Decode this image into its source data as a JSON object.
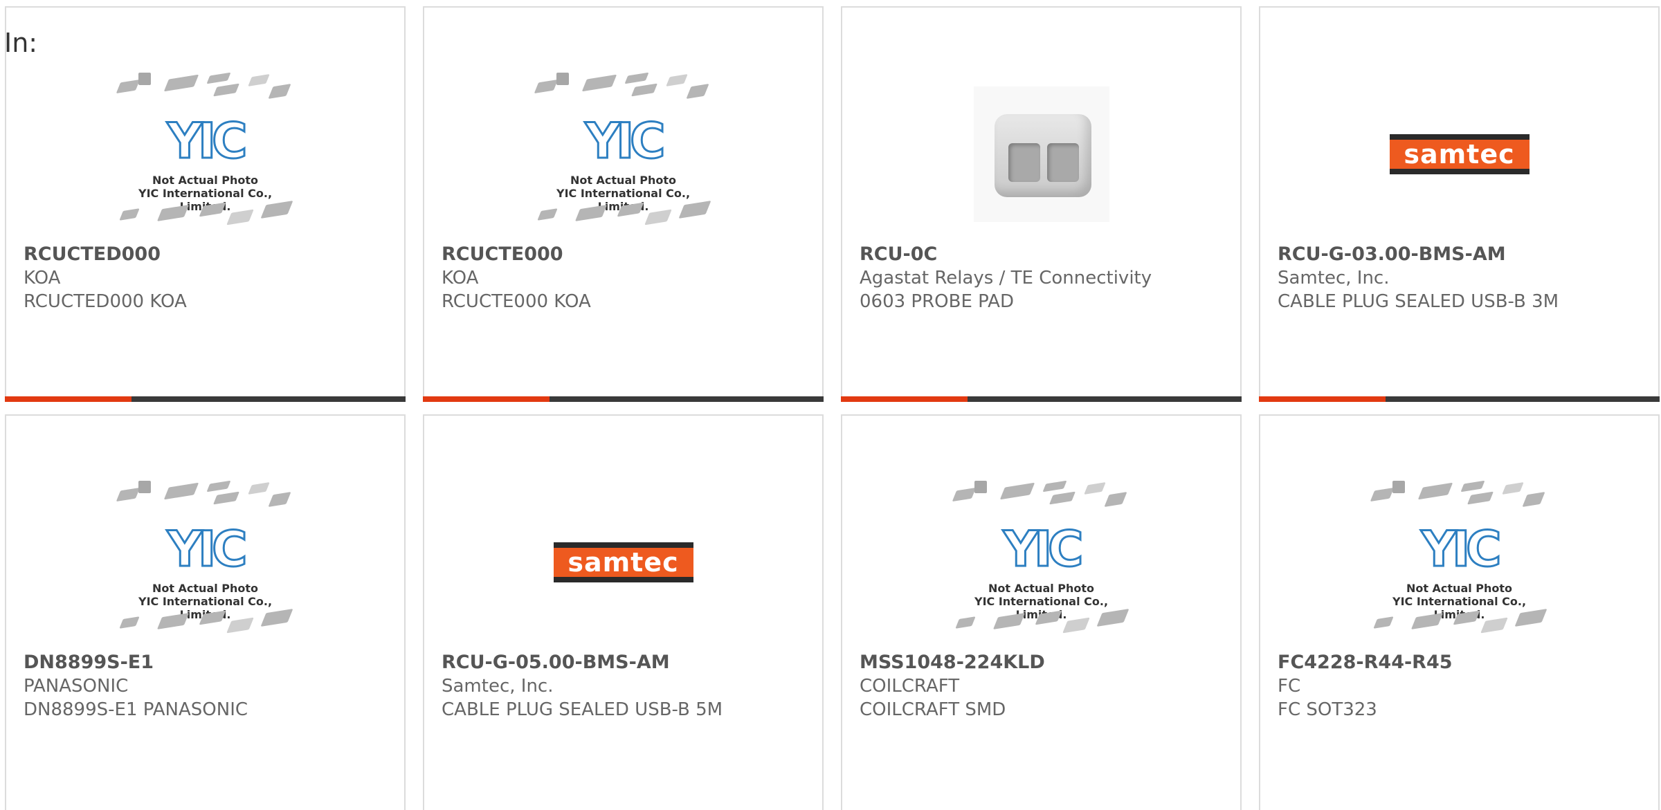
{
  "prefix": "In:",
  "placeholder": {
    "logo_text": "YIC",
    "caption_line1": "Not Actual Photo",
    "caption_line2": "YIC International Co., Limited."
  },
  "samtec_logo_text": "samtec",
  "products": [
    {
      "part_number": "RCUCTED000",
      "manufacturer": "KOA",
      "description": "RCUCTED000 KOA",
      "image": "placeholder"
    },
    {
      "part_number": "RCUCTE000",
      "manufacturer": "KOA",
      "description": "RCUCTE000 KOA",
      "image": "placeholder"
    },
    {
      "part_number": "RCU-0C",
      "manufacturer": "Agastat Relays / TE Connectivity",
      "description": "0603 PROBE PAD",
      "image": "relay"
    },
    {
      "part_number": "RCU-G-03.00-BMS-AM",
      "manufacturer": "Samtec, Inc.",
      "description": "CABLE PLUG SEALED USB-B 3M",
      "image": "samtec"
    },
    {
      "part_number": "DN8899S-E1",
      "manufacturer": "PANASONIC",
      "description": "DN8899S-E1 PANASONIC",
      "image": "placeholder"
    },
    {
      "part_number": "RCU-G-05.00-BMS-AM",
      "manufacturer": "Samtec, Inc.",
      "description": "CABLE PLUG SEALED USB-B 5M",
      "image": "samtec"
    },
    {
      "part_number": "MSS1048-224KLD",
      "manufacturer": "COILCRAFT",
      "description": "COILCRAFT SMD",
      "image": "placeholder"
    },
    {
      "part_number": "FC4228-R44-R45",
      "manufacturer": "FC",
      "description": "FC SOT323",
      "image": "placeholder"
    }
  ],
  "colors": {
    "accent_red": "#e23a11",
    "accent_dark": "#3a3a3a",
    "samtec_orange": "#ee5a1f",
    "yic_blue": "#2d7fc1"
  }
}
